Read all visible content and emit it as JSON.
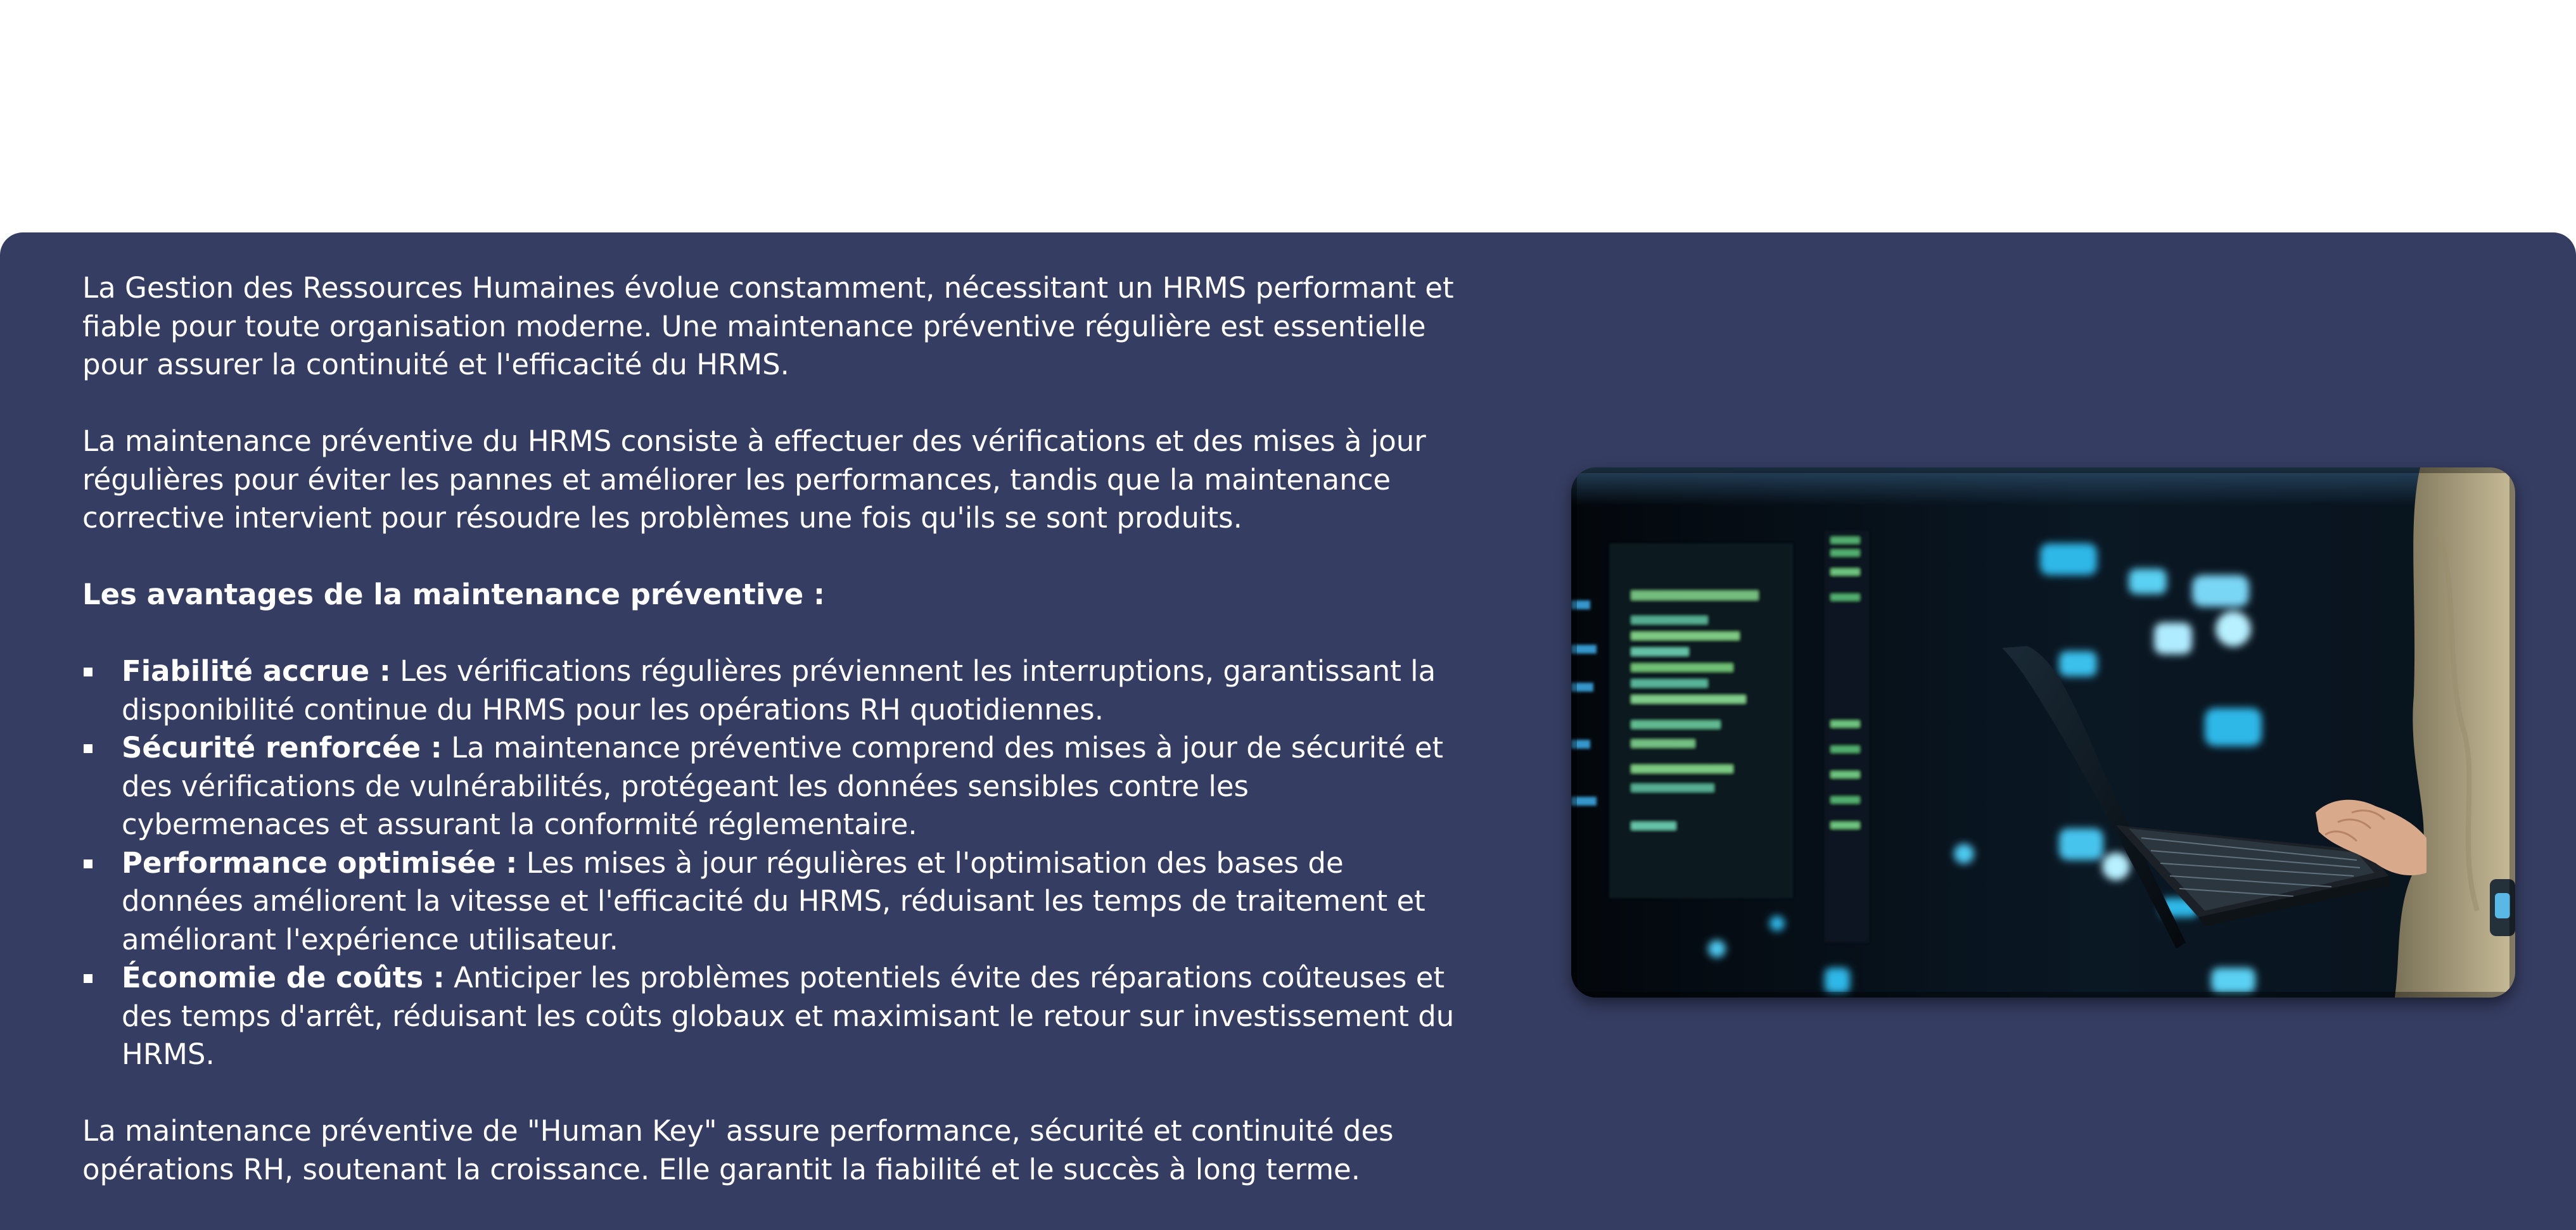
{
  "intro": "La Gestion des Ressources Humaines évolue constamment, nécessitant un HRMS performant et fiable pour toute organisation moderne. Une maintenance préventive régulière est essentielle pour assurer la continuité et l'efficacité du HRMS.",
  "definition": "La maintenance préventive du HRMS consiste à effectuer des vérifications et des mises à jour régulières pour éviter les pannes et améliorer les performances, tandis que la maintenance corrective intervient pour résoudre les problèmes une fois qu'ils se sont produits.",
  "benefits_heading": "Les avantages de la maintenance préventive :",
  "benefits": [
    {
      "term": "Fiabilité accrue :",
      "text": " Les vérifications régulières préviennent les interruptions, garantissant la disponibilité continue du HRMS pour les opérations RH quotidiennes."
    },
    {
      "term": "Sécurité renforcée :",
      "text": " La maintenance préventive comprend des mises à jour de sécurité et des vérifications de vulnérabilités, protégeant les données sensibles contre les cybermenaces et assurant la conformité réglementaire."
    },
    {
      "term": "Performance optimisée :",
      "text": " Les mises à jour régulières et l'optimisation des bases de données améliorent la vitesse et l'efficacité du HRMS, réduisant les temps de traitement et améliorant l'expérience utilisateur."
    },
    {
      "term": "Économie de coûts :",
      "text": " Anticiper les problèmes potentiels évite des réparations coûteuses et des temps d'arrêt, réduisant les coûts globaux et maximisant le retour sur investissement du HRMS."
    }
  ],
  "conclusion": "La maintenance préventive de \"Human Key\" assure performance, sécurité et continuité des opérations RH, soutenant la croissance. Elle garantit la fiabilité et le succès à long terme.",
  "colors": {
    "panel_background": "#353d62",
    "text": "#ffffff",
    "page_background": "#ffffff"
  },
  "image": {
    "subject": "person-typing-on-laptop-in-server-room"
  }
}
